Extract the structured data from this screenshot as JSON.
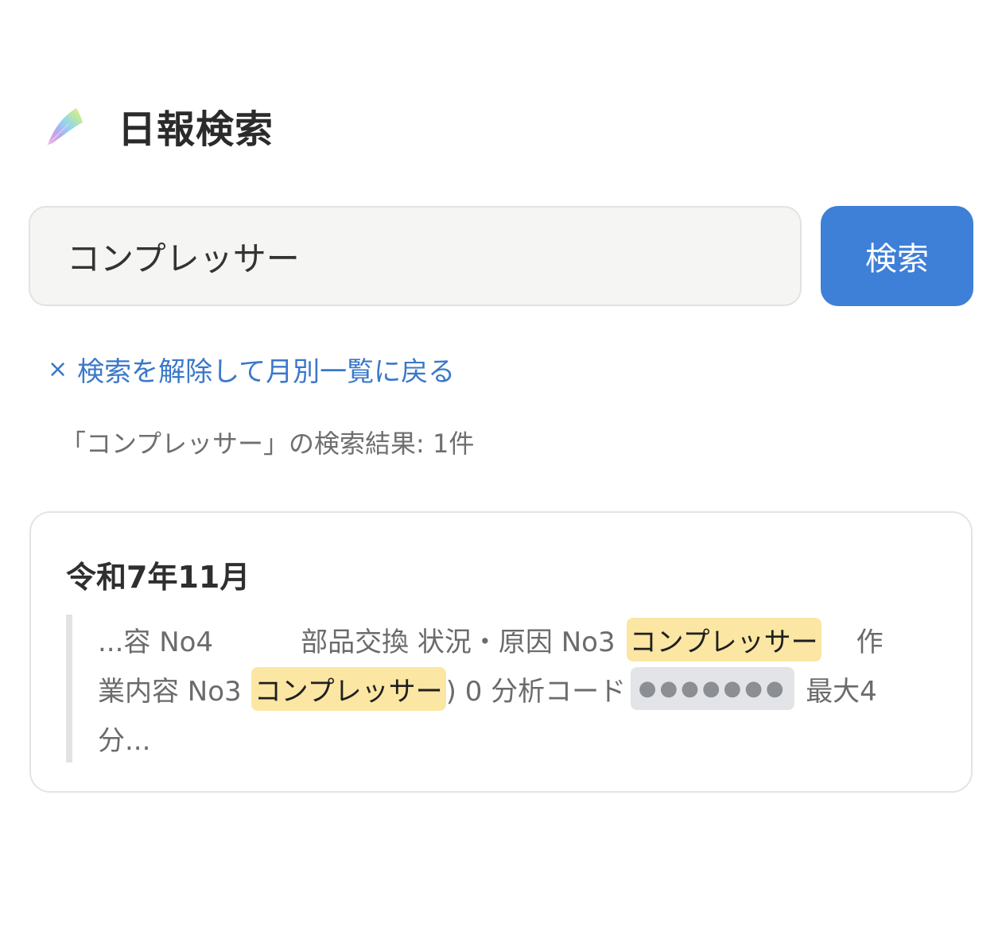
{
  "header": {
    "title": "日報検索",
    "logo_icon": "feather-icon"
  },
  "search": {
    "value": "コンプレッサー",
    "button_label": "検索"
  },
  "clear_link": {
    "x_mark": "×",
    "label": "検索を解除して月別一覧に戻る"
  },
  "result_summary": "「コンプレッサー」の検索結果: 1件",
  "results": [
    {
      "month": "令和7年11月",
      "snippet": {
        "line1_a": "...容 No4",
        "line1_b": "部品交換 状況・原因 No3",
        "line1_hl": "コンプレッサー",
        "line1_c": "作",
        "line2_a": "業内容 No3",
        "line2_hl": "コンプレッサー",
        "line2_b": ") 0 分析コード",
        "line2_mask": "●●●●●●●",
        "line2_c": "最大4",
        "line3": "分..."
      }
    }
  ],
  "colors": {
    "accent": "#3e7fd8",
    "link": "#3a78c9",
    "highlight": "#fbe6a3"
  }
}
